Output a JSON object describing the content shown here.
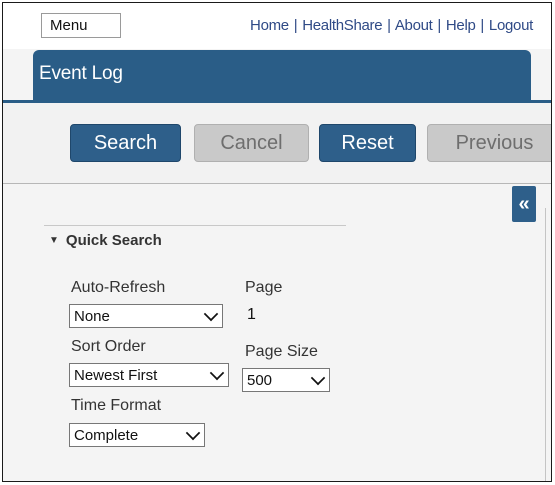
{
  "header": {
    "menu_label": "Menu",
    "links": [
      "Home",
      "HealthShare",
      "About",
      "Help",
      "Logout"
    ],
    "separator": "|"
  },
  "title": "Event Log",
  "toolbar": {
    "search_label": "Search",
    "cancel_label": "Cancel",
    "reset_label": "Reset",
    "previous_label": "Previous"
  },
  "collapse_label": "«",
  "quick_search": {
    "title": "Quick Search",
    "auto_refresh": {
      "label": "Auto-Refresh",
      "value": "None"
    },
    "page": {
      "label": "Page",
      "value": "1"
    },
    "sort_order": {
      "label": "Sort Order",
      "value": "Newest First"
    },
    "page_size": {
      "label": "Page Size",
      "value": "500"
    },
    "time_format": {
      "label": "Time Format",
      "value": "Complete"
    }
  },
  "colors": {
    "accent": "#2e5f8a",
    "link": "#2f4a86",
    "disabled": "#c9c9c9"
  }
}
